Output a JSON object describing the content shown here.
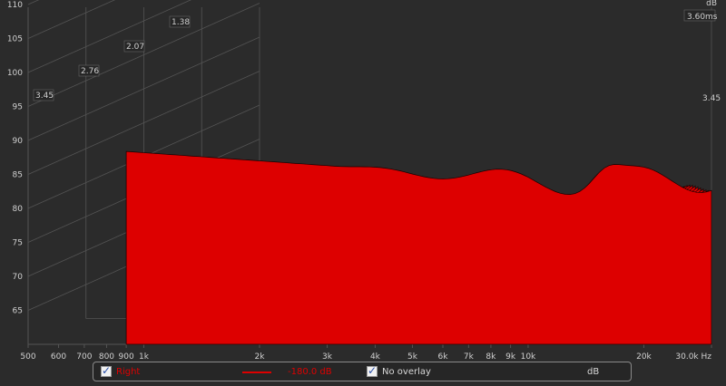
{
  "chart_data": {
    "type": "waterfall-3d",
    "y_axis": {
      "unit": "dB",
      "ticks": [
        65,
        70,
        75,
        80,
        85,
        90,
        95,
        100,
        105,
        110
      ],
      "range": [
        60,
        110
      ]
    },
    "x_axis": {
      "scale": "log",
      "range_hz": [
        500,
        30000
      ],
      "ticks": [
        {
          "hz": 500,
          "label": "500"
        },
        {
          "hz": 600,
          "label": "600"
        },
        {
          "hz": 700,
          "label": "700"
        },
        {
          "hz": 800,
          "label": "800"
        },
        {
          "hz": 900,
          "label": "900"
        },
        {
          "hz": 1000,
          "label": "1k"
        },
        {
          "hz": 2000,
          "label": "2k"
        },
        {
          "hz": 3000,
          "label": "3k"
        },
        {
          "hz": 4000,
          "label": "4k"
        },
        {
          "hz": 5000,
          "label": "5k"
        },
        {
          "hz": 6000,
          "label": "6k"
        },
        {
          "hz": 7000,
          "label": "7k"
        },
        {
          "hz": 8000,
          "label": "8k"
        },
        {
          "hz": 9000,
          "label": "9k"
        },
        {
          "hz": 10000,
          "label": "10k"
        },
        {
          "hz": 20000,
          "label": "20k"
        },
        {
          "hz": 30000,
          "label": "30.0k Hz"
        }
      ]
    },
    "time_axis": {
      "unit": "ms",
      "ticks": [
        "3.45",
        "2.76",
        "2.07",
        "1.38"
      ],
      "end_label": "3.60ms",
      "right_label": "3.45"
    },
    "series_color": "#dd0000",
    "slice_count": 44
  },
  "legend": {
    "right_label": "Right",
    "right_checked": "✓",
    "line_value": "-180.0 dB",
    "overlay_label": "No overlay",
    "overlay_checked": "✓",
    "unit": "dB"
  },
  "colors": {
    "background": "#2b2b2b",
    "grid": "#545454",
    "text": "#d0d0d0",
    "accent": "#dd0000"
  }
}
